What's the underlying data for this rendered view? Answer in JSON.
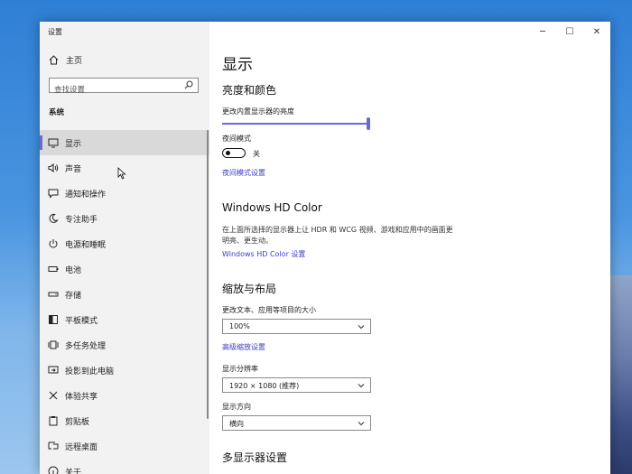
{
  "window": {
    "title": "设置",
    "controls": {
      "minimize": "─",
      "maximize": "☐",
      "close": "✕"
    }
  },
  "sidebar": {
    "home_label": "主页",
    "search_placeholder": "查找设置",
    "section_label": "系统",
    "items": [
      {
        "label": "显示",
        "icon": "monitor-icon",
        "selected": true
      },
      {
        "label": "声音",
        "icon": "speaker-icon"
      },
      {
        "label": "通知和操作",
        "icon": "notification-icon"
      },
      {
        "label": "专注助手",
        "icon": "moon-icon"
      },
      {
        "label": "电源和睡眠",
        "icon": "power-icon"
      },
      {
        "label": "电池",
        "icon": "battery-icon"
      },
      {
        "label": "存储",
        "icon": "storage-icon"
      },
      {
        "label": "平板模式",
        "icon": "tablet-icon"
      },
      {
        "label": "多任务处理",
        "icon": "multitask-icon"
      },
      {
        "label": "投影到此电脑",
        "icon": "project-icon"
      },
      {
        "label": "体验共享",
        "icon": "share-icon"
      },
      {
        "label": "剪贴板",
        "icon": "clipboard-icon"
      },
      {
        "label": "远程桌面",
        "icon": "remote-desktop-icon"
      },
      {
        "label": "关于",
        "icon": "info-icon"
      }
    ]
  },
  "main": {
    "page_title": "显示",
    "brightness": {
      "heading": "亮度和颜色",
      "slider_label": "更改内置显示器的亮度",
      "brightness_level": 1.0,
      "night_light_label": "夜间模式",
      "night_light_state": "关",
      "night_light_settings_link": "夜间模式设置"
    },
    "hdr": {
      "heading": "Windows HD Color",
      "description": "在上面所选择的显示器上让 HDR 和 WCG 视频、游戏和应用中的画面更明亮、更生动。",
      "link": "Windows HD Color 设置"
    },
    "scale": {
      "heading": "缩放与布局",
      "scale_label": "更改文本、应用等项目的大小",
      "scale_value": "100%",
      "advanced_link": "高级缩放设置",
      "resolution_label": "显示分辨率",
      "resolution_value": "1920 × 1080 (推荐)",
      "orientation_label": "显示方向",
      "orientation_value": "横向"
    },
    "multi_display": {
      "heading": "多显示器设置"
    }
  },
  "colors": {
    "accent": "#6b69d6",
    "link": "#3c3cc8",
    "sidebar_bg": "#f2f2f2",
    "selected_bg": "#d9d9d9"
  }
}
